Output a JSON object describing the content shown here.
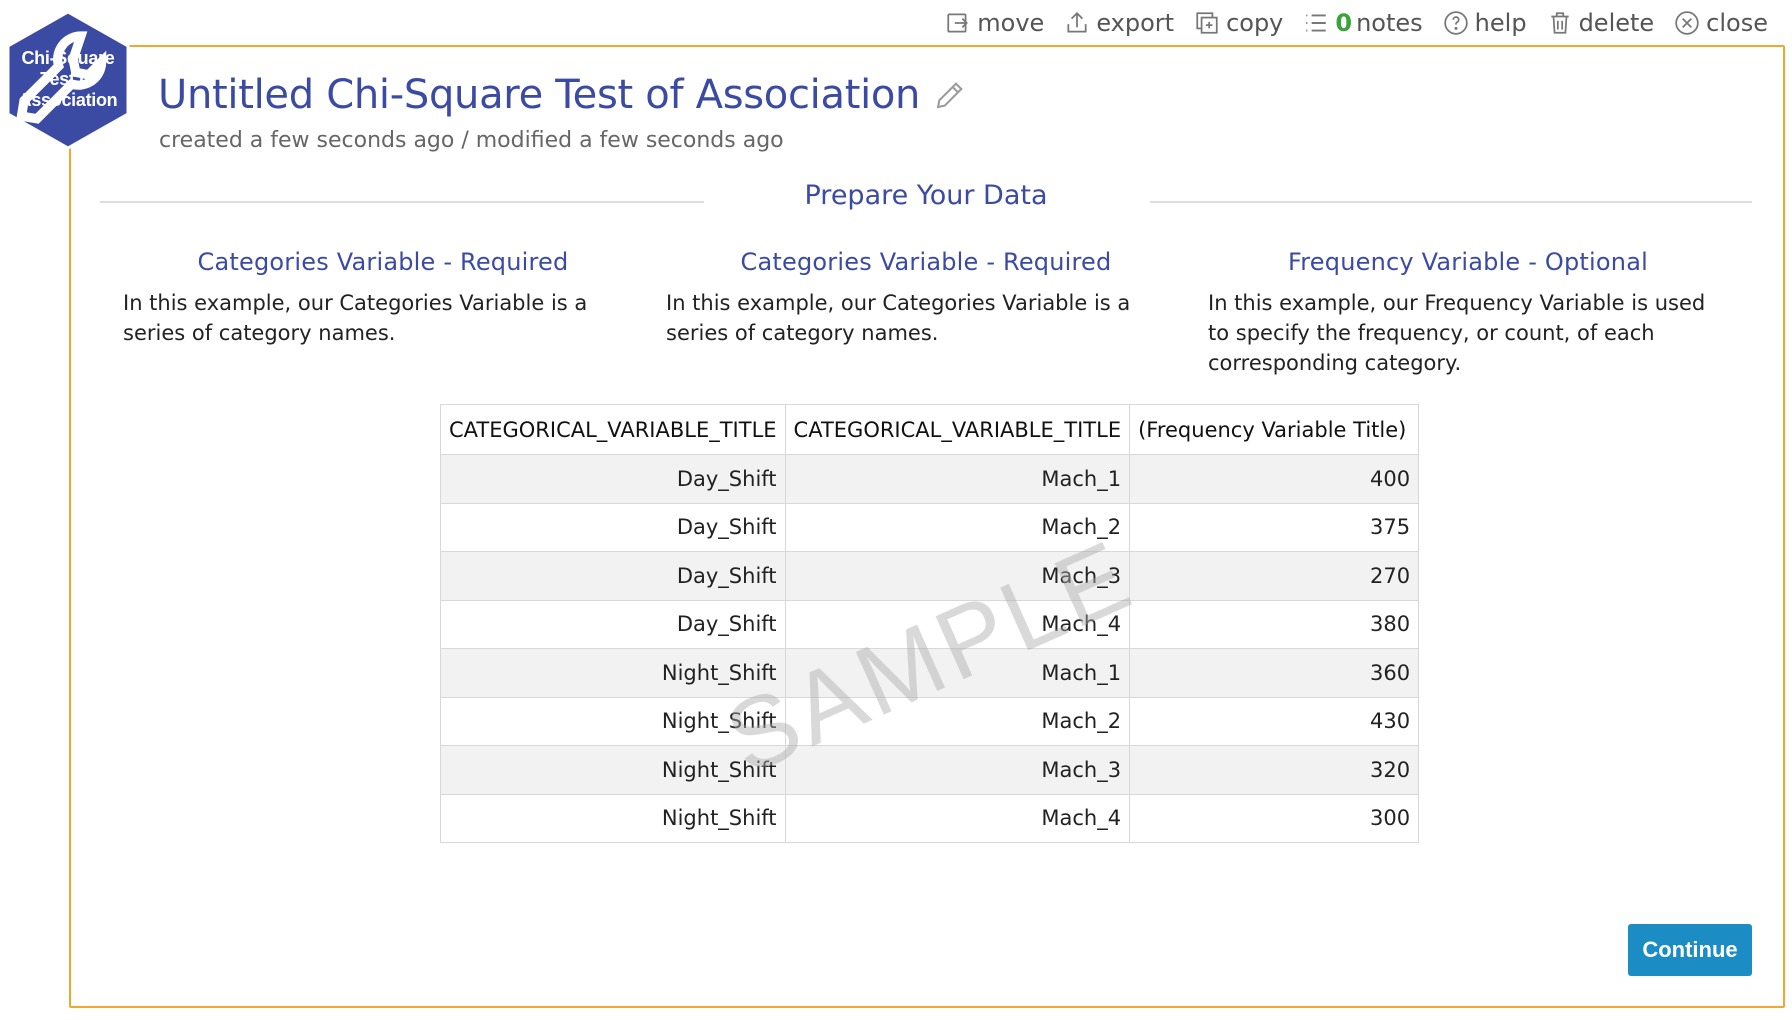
{
  "toolbar": {
    "move": "move",
    "export": "export",
    "copy": "copy",
    "notes_count": "0",
    "notes": "notes",
    "help": "help",
    "delete": "delete",
    "close": "close"
  },
  "badge": {
    "label": "Chi-Square Test of Association",
    "icon": "wrench-icon",
    "color": "#3b4aa3"
  },
  "header": {
    "title": "Untitled Chi-Square Test of Association",
    "subtitle": "created a few seconds ago / modified a few seconds ago"
  },
  "section": {
    "title": "Prepare Your Data"
  },
  "columns": [
    {
      "heading": "Categories Variable - Required",
      "text": "In this example, our Categories Variable is a series of category names."
    },
    {
      "heading": "Categories Variable - Required",
      "text": "In this example, our Categories Variable is a series of category names."
    },
    {
      "heading": "Frequency Variable - Optional",
      "text": "In this example, our Frequency Variable is used to specify the frequency, or count, of each corresponding category."
    }
  ],
  "table": {
    "headers": [
      "CATEGORICAL_VARIABLE_TITLE",
      "CATEGORICAL_VARIABLE_TITLE",
      "(Frequency Variable Title)"
    ],
    "rows": [
      [
        "Day_Shift",
        "Mach_1",
        "400"
      ],
      [
        "Day_Shift",
        "Mach_2",
        "375"
      ],
      [
        "Day_Shift",
        "Mach_3",
        "270"
      ],
      [
        "Day_Shift",
        "Mach_4",
        "380"
      ],
      [
        "Night_Shift",
        "Mach_1",
        "360"
      ],
      [
        "Night_Shift",
        "Mach_2",
        "430"
      ],
      [
        "Night_Shift",
        "Mach_3",
        "320"
      ],
      [
        "Night_Shift",
        "Mach_4",
        "300"
      ]
    ]
  },
  "watermark": "SAMPLE",
  "continue_label": "Continue",
  "colors": {
    "accent": "#3b4aa3",
    "frame": "#f0a830",
    "button": "#1b8cc4",
    "notes_count": "#3aa33a"
  }
}
